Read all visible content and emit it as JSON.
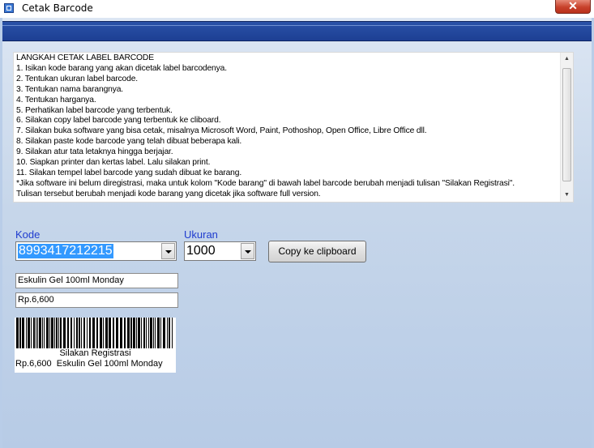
{
  "window": {
    "title": "Cetak Barcode",
    "close_glyph": "✕"
  },
  "instructions": {
    "lines": [
      "LANGKAH CETAK LABEL BARCODE",
      "1. Isikan kode barang yang akan dicetak label barcodenya.",
      "2. Tentukan ukuran label barcode.",
      "3. Tentukan nama barangnya.",
      "4. Tentukan harganya.",
      "5. Perhatikan label barcode yang terbentuk.",
      "6. Silakan copy label barcode yang terbentuk ke cliboard.",
      "7. Silakan buka software yang bisa cetak, misalnya Microsoft Word, Paint, Pothoshop, Open Office, Libre Office dll.",
      "8. Silakan paste kode barcode yang telah dibuat beberapa kali.",
      "9. Silakan atur tata letaknya hingga berjajar.",
      "10. Siapkan printer dan kertas label. Lalu silakan print.",
      "11. Silakan tempel label barcode yang sudah dibuat ke barang.",
      "*Jika software ini belum diregistrasi, maka untuk kolom \"Kode barang\" di bawah label barcode berubah menjadi tulisan \"Silakan Registrasi\".",
      "Tulisan tersebut berubah menjadi kode barang yang dicetak jika software full version."
    ]
  },
  "form": {
    "kode_label": "Kode",
    "kode_value": "8993417212215",
    "ukuran_label": "Ukuran",
    "ukuran_value": "1000",
    "copy_button": "Copy ke clipboard",
    "nama_barang": "Eskulin Gel 100ml Monday",
    "harga": "Rp.6,600"
  },
  "barcode": {
    "status_text": "Silakan Registrasi",
    "caption": "Rp.6,600  Eskulin Gel 100ml Monday"
  },
  "colors": {
    "label_blue": "#1f3ccf",
    "toolbar_blue": "#1d3f93",
    "selection": "#3399ff"
  }
}
